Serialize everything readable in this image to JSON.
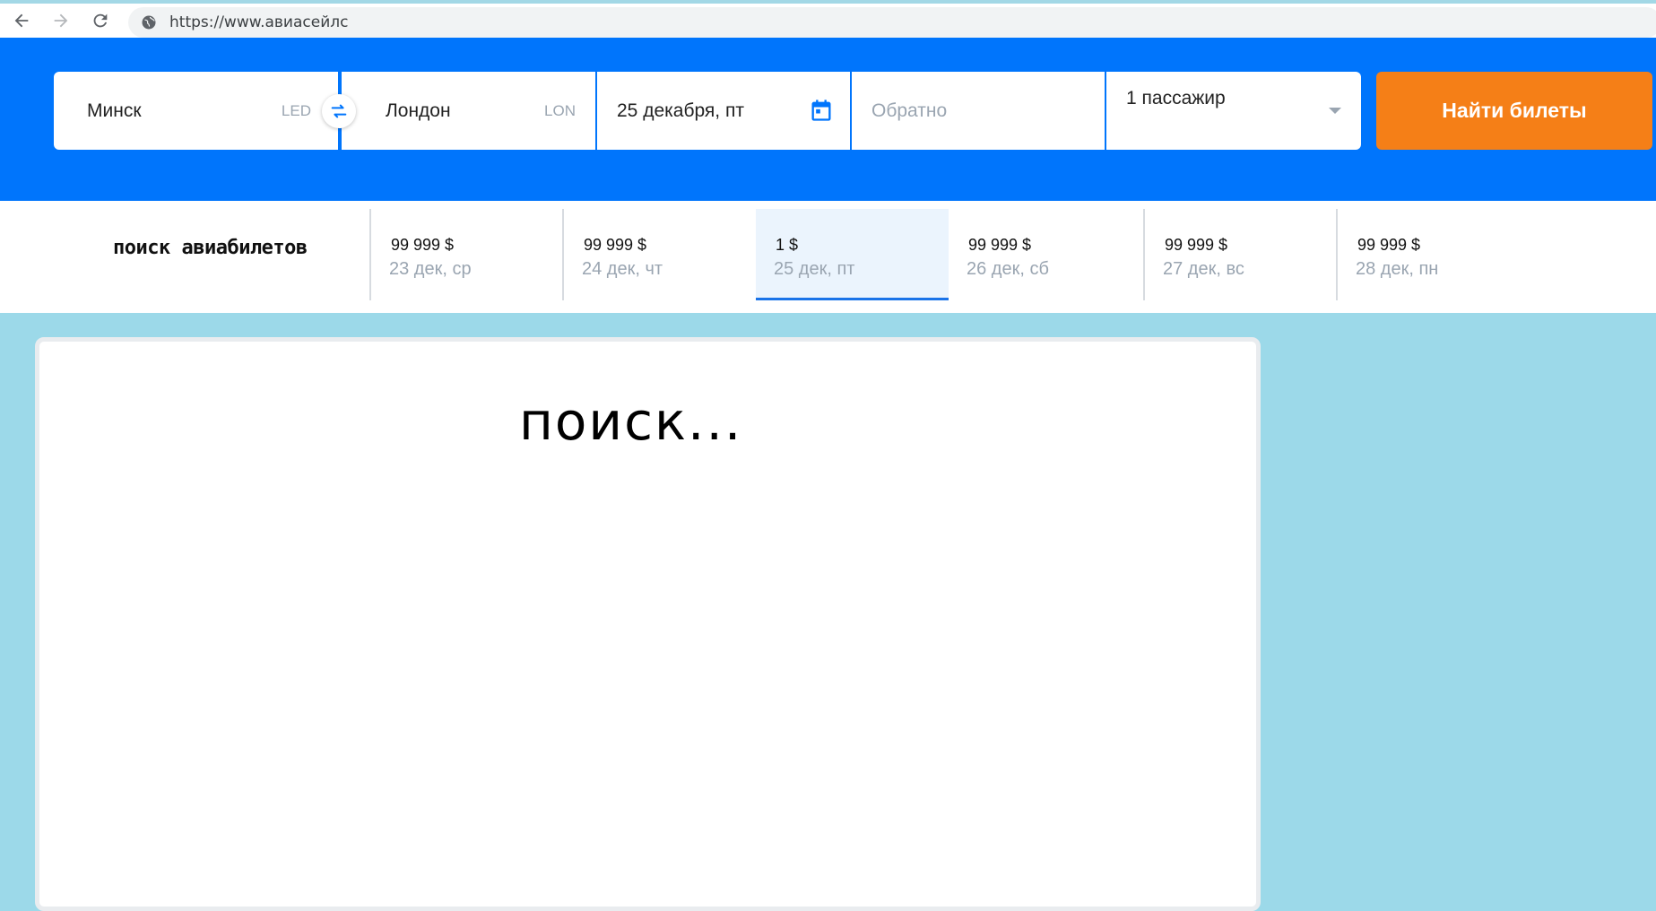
{
  "browser": {
    "url": "https://www.авиасейлс"
  },
  "search": {
    "origin": {
      "city": "Минск",
      "iata": "LED"
    },
    "destination": {
      "city": "Лондон",
      "iata": "LON"
    },
    "depart_date": "25 декабря, пт",
    "return_placeholder": "Обратно",
    "passengers": "1 пассажир",
    "submit_label": "Найти билеты"
  },
  "date_strip": {
    "title": "поиск авиабилетов",
    "days": [
      {
        "price": "99 999 $",
        "date": "23 дек, ср"
      },
      {
        "price": "99 999 $",
        "date": "24 дек, чт"
      },
      {
        "price": "1 $",
        "date": "25 дек, пт",
        "selected": true
      },
      {
        "price": "99 999 $",
        "date": "26 дек, сб"
      },
      {
        "price": "99 999 $",
        "date": "27 дек, вс"
      },
      {
        "price": "99 999 $",
        "date": "28 дек, пн"
      }
    ]
  },
  "results": {
    "status": "поиск..."
  },
  "colors": {
    "header_blue": "#0075fc",
    "button_orange": "#f57f17",
    "page_bg": "#9cd9e9",
    "selected_day_bg": "#ebf4fd"
  }
}
